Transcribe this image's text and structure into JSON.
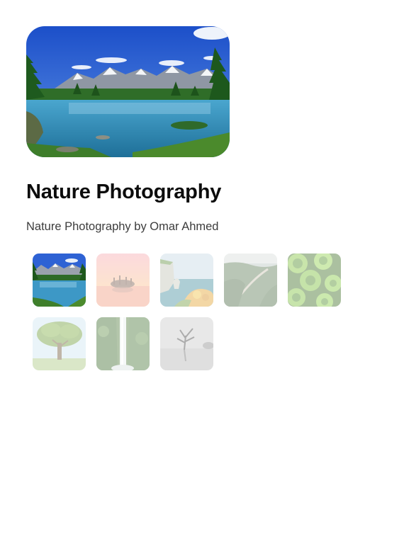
{
  "gallery": {
    "title": "Nature Photography",
    "subtitle": "Nature Photography by Omar Ahmed",
    "selected_index": 0,
    "thumbnails": [
      {
        "subject": "mountain-lake",
        "selected": true
      },
      {
        "subject": "sunset-island-trees",
        "selected": false
      },
      {
        "subject": "coastal-cliff-arch",
        "selected": false
      },
      {
        "subject": "hill-path-valley",
        "selected": false
      },
      {
        "subject": "green-succulent-leaves",
        "selected": false
      },
      {
        "subject": "lone-tree-field",
        "selected": false
      },
      {
        "subject": "forest-waterfall",
        "selected": false
      },
      {
        "subject": "misty-tree-lake",
        "selected": false
      }
    ]
  },
  "colors": {
    "background": "#ffffff",
    "title": "#0c0c0c",
    "subtitle": "#3c3c3c"
  }
}
